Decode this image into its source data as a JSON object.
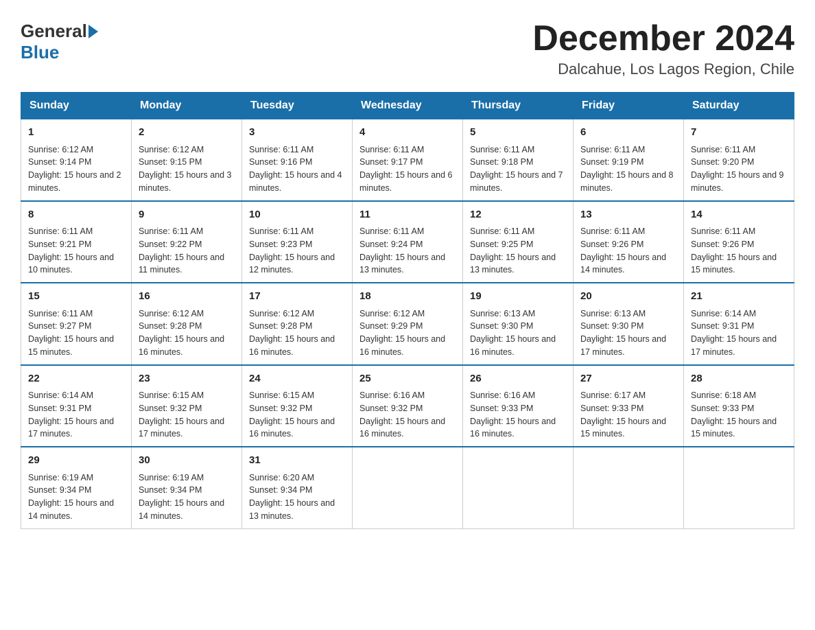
{
  "header": {
    "logo_general": "General",
    "logo_blue": "Blue",
    "month_title": "December 2024",
    "location": "Dalcahue, Los Lagos Region, Chile"
  },
  "days_of_week": [
    "Sunday",
    "Monday",
    "Tuesday",
    "Wednesday",
    "Thursday",
    "Friday",
    "Saturday"
  ],
  "weeks": [
    [
      {
        "day": "1",
        "sunrise": "6:12 AM",
        "sunset": "9:14 PM",
        "daylight": "15 hours and 2 minutes."
      },
      {
        "day": "2",
        "sunrise": "6:12 AM",
        "sunset": "9:15 PM",
        "daylight": "15 hours and 3 minutes."
      },
      {
        "day": "3",
        "sunrise": "6:11 AM",
        "sunset": "9:16 PM",
        "daylight": "15 hours and 4 minutes."
      },
      {
        "day": "4",
        "sunrise": "6:11 AM",
        "sunset": "9:17 PM",
        "daylight": "15 hours and 6 minutes."
      },
      {
        "day": "5",
        "sunrise": "6:11 AM",
        "sunset": "9:18 PM",
        "daylight": "15 hours and 7 minutes."
      },
      {
        "day": "6",
        "sunrise": "6:11 AM",
        "sunset": "9:19 PM",
        "daylight": "15 hours and 8 minutes."
      },
      {
        "day": "7",
        "sunrise": "6:11 AM",
        "sunset": "9:20 PM",
        "daylight": "15 hours and 9 minutes."
      }
    ],
    [
      {
        "day": "8",
        "sunrise": "6:11 AM",
        "sunset": "9:21 PM",
        "daylight": "15 hours and 10 minutes."
      },
      {
        "day": "9",
        "sunrise": "6:11 AM",
        "sunset": "9:22 PM",
        "daylight": "15 hours and 11 minutes."
      },
      {
        "day": "10",
        "sunrise": "6:11 AM",
        "sunset": "9:23 PM",
        "daylight": "15 hours and 12 minutes."
      },
      {
        "day": "11",
        "sunrise": "6:11 AM",
        "sunset": "9:24 PM",
        "daylight": "15 hours and 13 minutes."
      },
      {
        "day": "12",
        "sunrise": "6:11 AM",
        "sunset": "9:25 PM",
        "daylight": "15 hours and 13 minutes."
      },
      {
        "day": "13",
        "sunrise": "6:11 AM",
        "sunset": "9:26 PM",
        "daylight": "15 hours and 14 minutes."
      },
      {
        "day": "14",
        "sunrise": "6:11 AM",
        "sunset": "9:26 PM",
        "daylight": "15 hours and 15 minutes."
      }
    ],
    [
      {
        "day": "15",
        "sunrise": "6:11 AM",
        "sunset": "9:27 PM",
        "daylight": "15 hours and 15 minutes."
      },
      {
        "day": "16",
        "sunrise": "6:12 AM",
        "sunset": "9:28 PM",
        "daylight": "15 hours and 16 minutes."
      },
      {
        "day": "17",
        "sunrise": "6:12 AM",
        "sunset": "9:28 PM",
        "daylight": "15 hours and 16 minutes."
      },
      {
        "day": "18",
        "sunrise": "6:12 AM",
        "sunset": "9:29 PM",
        "daylight": "15 hours and 16 minutes."
      },
      {
        "day": "19",
        "sunrise": "6:13 AM",
        "sunset": "9:30 PM",
        "daylight": "15 hours and 16 minutes."
      },
      {
        "day": "20",
        "sunrise": "6:13 AM",
        "sunset": "9:30 PM",
        "daylight": "15 hours and 17 minutes."
      },
      {
        "day": "21",
        "sunrise": "6:14 AM",
        "sunset": "9:31 PM",
        "daylight": "15 hours and 17 minutes."
      }
    ],
    [
      {
        "day": "22",
        "sunrise": "6:14 AM",
        "sunset": "9:31 PM",
        "daylight": "15 hours and 17 minutes."
      },
      {
        "day": "23",
        "sunrise": "6:15 AM",
        "sunset": "9:32 PM",
        "daylight": "15 hours and 17 minutes."
      },
      {
        "day": "24",
        "sunrise": "6:15 AM",
        "sunset": "9:32 PM",
        "daylight": "15 hours and 16 minutes."
      },
      {
        "day": "25",
        "sunrise": "6:16 AM",
        "sunset": "9:32 PM",
        "daylight": "15 hours and 16 minutes."
      },
      {
        "day": "26",
        "sunrise": "6:16 AM",
        "sunset": "9:33 PM",
        "daylight": "15 hours and 16 minutes."
      },
      {
        "day": "27",
        "sunrise": "6:17 AM",
        "sunset": "9:33 PM",
        "daylight": "15 hours and 15 minutes."
      },
      {
        "day": "28",
        "sunrise": "6:18 AM",
        "sunset": "9:33 PM",
        "daylight": "15 hours and 15 minutes."
      }
    ],
    [
      {
        "day": "29",
        "sunrise": "6:19 AM",
        "sunset": "9:34 PM",
        "daylight": "15 hours and 14 minutes."
      },
      {
        "day": "30",
        "sunrise": "6:19 AM",
        "sunset": "9:34 PM",
        "daylight": "15 hours and 14 minutes."
      },
      {
        "day": "31",
        "sunrise": "6:20 AM",
        "sunset": "9:34 PM",
        "daylight": "15 hours and 13 minutes."
      },
      null,
      null,
      null,
      null
    ]
  ]
}
